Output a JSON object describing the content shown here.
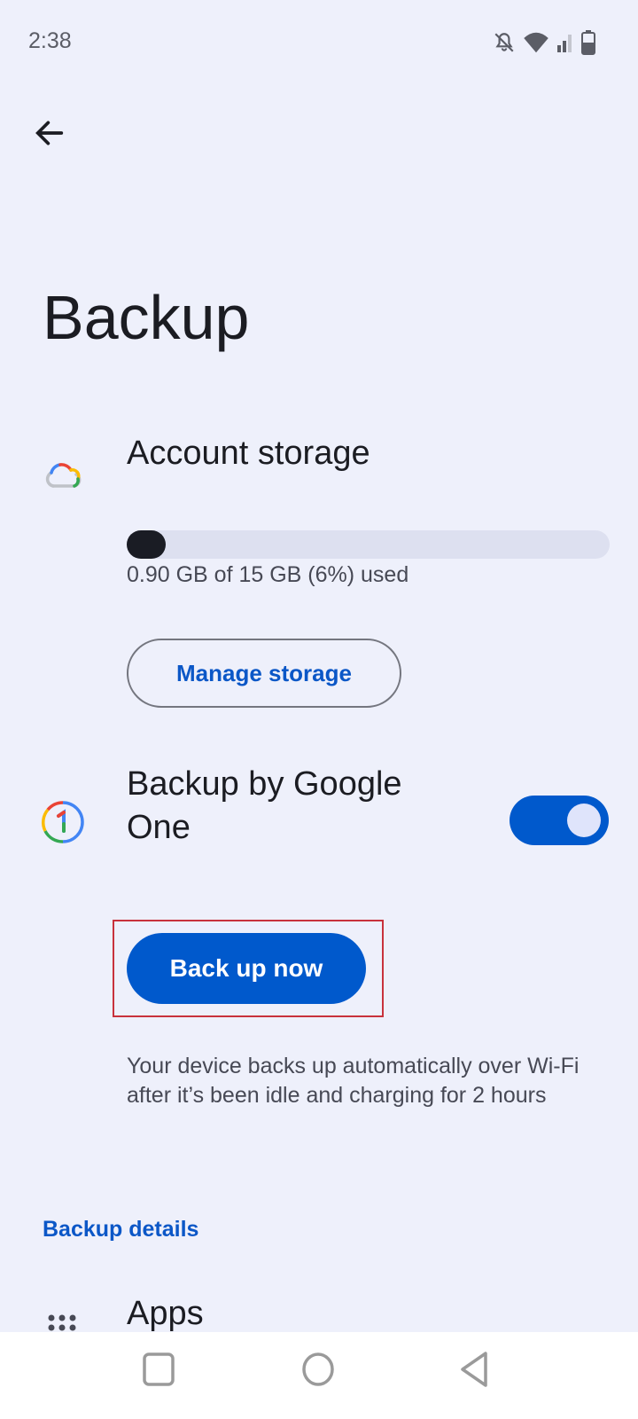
{
  "status_bar": {
    "time": "2:38",
    "icons": [
      "notifications-off-icon",
      "wifi-icon",
      "signal-icon",
      "battery-icon"
    ]
  },
  "header": {
    "back_icon": "arrow-back-icon",
    "title": "Backup"
  },
  "account_storage": {
    "icon": "google-cloud-icon",
    "title": "Account storage",
    "used_fraction": 0.06,
    "usage_text": "0.90 GB of 15 GB (6%) used",
    "manage_button": "Manage storage"
  },
  "google_one_backup": {
    "icon": "google-one-icon",
    "title": "Backup by Google One",
    "enabled": true,
    "backup_now_button": "Back up now",
    "description": "Your device backs up automatically over Wi-Fi after it’s been idle and charging for 2 hours"
  },
  "backup_details": {
    "section_label": "Backup details",
    "items": [
      {
        "icon": "apps-grid-icon",
        "label": "Apps"
      }
    ]
  },
  "nav_bar": {
    "buttons": [
      "recents-button",
      "home-button",
      "back-button"
    ]
  },
  "colors": {
    "accent": "#0059cc",
    "background": "#eef0fb",
    "highlight": "#c8323c"
  }
}
